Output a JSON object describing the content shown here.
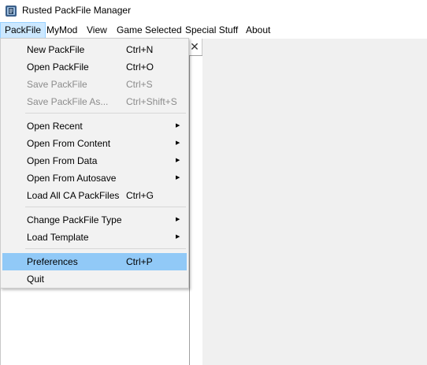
{
  "window": {
    "title": "Rusted PackFile Manager",
    "icon": "rpfm-app-icon"
  },
  "menubar": {
    "items": [
      {
        "label": "PackFile",
        "active": true
      },
      {
        "label": "MyMod"
      },
      {
        "label": "View"
      },
      {
        "label": "Game Selected"
      },
      {
        "label": "Special Stuff"
      },
      {
        "label": "About"
      }
    ]
  },
  "pane": {
    "close_glyph": "✕"
  },
  "packfile_menu": {
    "items": [
      {
        "label": "New PackFile",
        "shortcut": "Ctrl+N"
      },
      {
        "label": "Open PackFile",
        "shortcut": "Ctrl+O"
      },
      {
        "label": "Save PackFile",
        "shortcut": "Ctrl+S",
        "disabled": true
      },
      {
        "label": "Save PackFile As...",
        "shortcut": "Ctrl+Shift+S",
        "disabled": true
      },
      {
        "label": "Open Recent",
        "submenu": true
      },
      {
        "label": "Open From Content",
        "submenu": true
      },
      {
        "label": "Open From Data",
        "submenu": true
      },
      {
        "label": "Open From Autosave",
        "submenu": true
      },
      {
        "label": "Load All CA PackFiles",
        "shortcut": "Ctrl+G"
      },
      {
        "label": "Change PackFile Type",
        "submenu": true
      },
      {
        "label": "Load Template",
        "submenu": true
      },
      {
        "label": "Preferences",
        "shortcut": "Ctrl+P",
        "highlighted": true
      },
      {
        "label": "Quit"
      }
    ],
    "submenu_arrow": "▶"
  },
  "colors": {
    "menu_highlight": "#91c9f7",
    "menubar_active": "#cce8ff",
    "disabled_text": "#8c8c8c",
    "menu_background": "#f2f2f2",
    "workspace_background": "#f0f0f0"
  }
}
